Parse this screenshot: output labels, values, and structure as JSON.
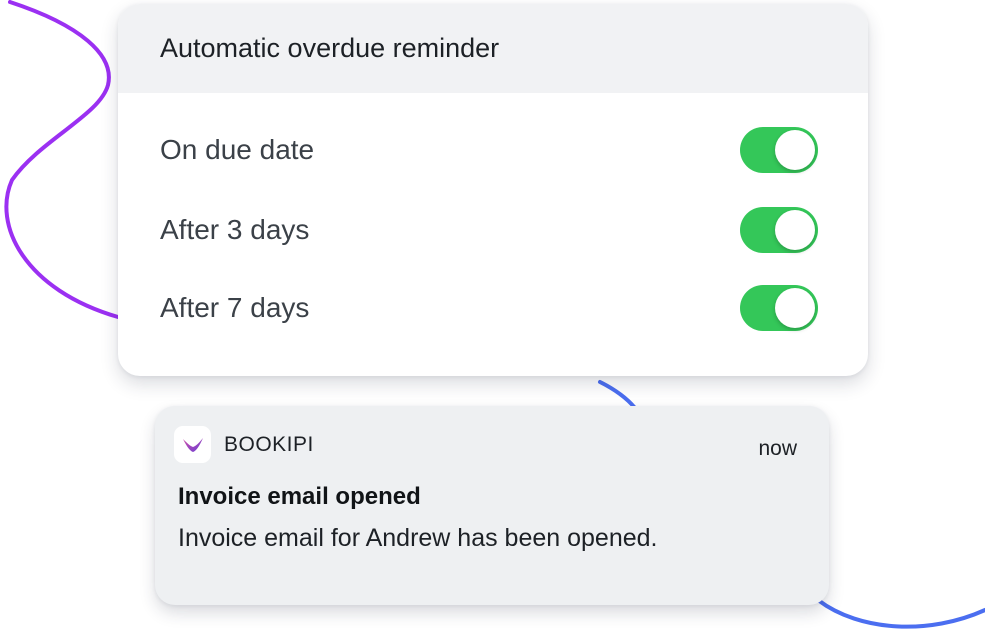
{
  "reminder_panel": {
    "title": "Automatic overdue reminder",
    "options": [
      {
        "label": "On due date",
        "enabled": true
      },
      {
        "label": "After 3 days",
        "enabled": true
      },
      {
        "label": "After 7 days",
        "enabled": true
      }
    ],
    "toggle_on_color": "#34c759"
  },
  "notification": {
    "app_name": "BOOKIPI",
    "app_icon": "bookipi-logo-icon",
    "time": "now",
    "title": "Invoice email opened",
    "body": "Invoice email for Andrew has been opened."
  },
  "colors": {
    "purple_curve": "#9b30f2",
    "blue_curve": "#4b6ef0"
  }
}
